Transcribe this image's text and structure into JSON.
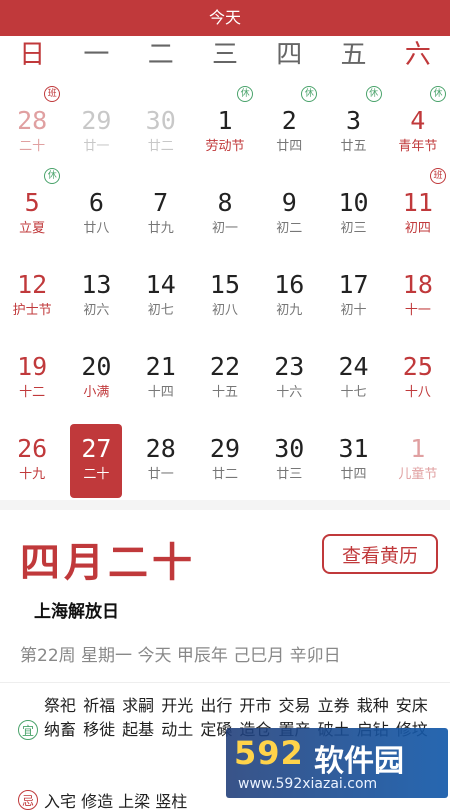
{
  "header": {
    "title": "今天"
  },
  "weekdays": [
    "日",
    "一",
    "二",
    "三",
    "四",
    "五",
    "六"
  ],
  "weeks": [
    [
      {
        "day": "28",
        "sub": "二十",
        "badge": "班",
        "faded": true,
        "red": true
      },
      {
        "day": "29",
        "sub": "廿一",
        "faded": true
      },
      {
        "day": "30",
        "sub": "廿二",
        "faded": true
      },
      {
        "day": "1",
        "sub": "劳动节",
        "badge": "休",
        "fest": true
      },
      {
        "day": "2",
        "sub": "廿四",
        "badge": "休"
      },
      {
        "day": "3",
        "sub": "廿五",
        "badge": "休"
      },
      {
        "day": "4",
        "sub": "青年节",
        "badge": "休",
        "red": true
      }
    ],
    [
      {
        "day": "5",
        "sub": "立夏",
        "badge": "休",
        "red": true
      },
      {
        "day": "6",
        "sub": "廿八"
      },
      {
        "day": "7",
        "sub": "廿九"
      },
      {
        "day": "8",
        "sub": "初一"
      },
      {
        "day": "9",
        "sub": "初二"
      },
      {
        "day": "10",
        "sub": "初三"
      },
      {
        "day": "11",
        "sub": "初四",
        "badge": "班",
        "red": true
      }
    ],
    [
      {
        "day": "12",
        "sub": "护士节",
        "red": true
      },
      {
        "day": "13",
        "sub": "初六"
      },
      {
        "day": "14",
        "sub": "初七"
      },
      {
        "day": "15",
        "sub": "初八"
      },
      {
        "day": "16",
        "sub": "初九"
      },
      {
        "day": "17",
        "sub": "初十"
      },
      {
        "day": "18",
        "sub": "十一",
        "red": true
      }
    ],
    [
      {
        "day": "19",
        "sub": "十二",
        "red": true
      },
      {
        "day": "20",
        "sub": "小满",
        "fest": true
      },
      {
        "day": "21",
        "sub": "十四"
      },
      {
        "day": "22",
        "sub": "十五"
      },
      {
        "day": "23",
        "sub": "十六"
      },
      {
        "day": "24",
        "sub": "十七"
      },
      {
        "day": "25",
        "sub": "十八",
        "red": true
      }
    ],
    [
      {
        "day": "26",
        "sub": "十九",
        "red": true
      },
      {
        "day": "27",
        "sub": "二十",
        "selected": true
      },
      {
        "day": "28",
        "sub": "廿一"
      },
      {
        "day": "29",
        "sub": "廿二"
      },
      {
        "day": "30",
        "sub": "廿三"
      },
      {
        "day": "31",
        "sub": "廿四"
      },
      {
        "day": "1",
        "sub": "儿童节",
        "faded": true,
        "red": true
      }
    ]
  ],
  "detail": {
    "lunar_date": "四月二十",
    "almanac_button": "查看黄历",
    "festival": "上海解放日",
    "info_line": "第22周 星期一 今天 甲辰年 己巳月 辛卯日"
  },
  "almanac": {
    "yi_icon": "宜",
    "yi_text": "祭祀 祈福 求嗣 开光 出行 开市 交易 立券 栽种 安床 纳畜 移徙 起基 动土 定磉 造仓 置产 破土 启钻 修坟",
    "ji_icon": "忌",
    "ji_text": "入宅 修造 上梁 竖柱"
  },
  "watermark": {
    "logo": "592",
    "name": "软件园",
    "url": "www.592xiazai.com"
  },
  "colors": {
    "accent": "#c0393b",
    "holiday_green": "#4aa36b"
  }
}
